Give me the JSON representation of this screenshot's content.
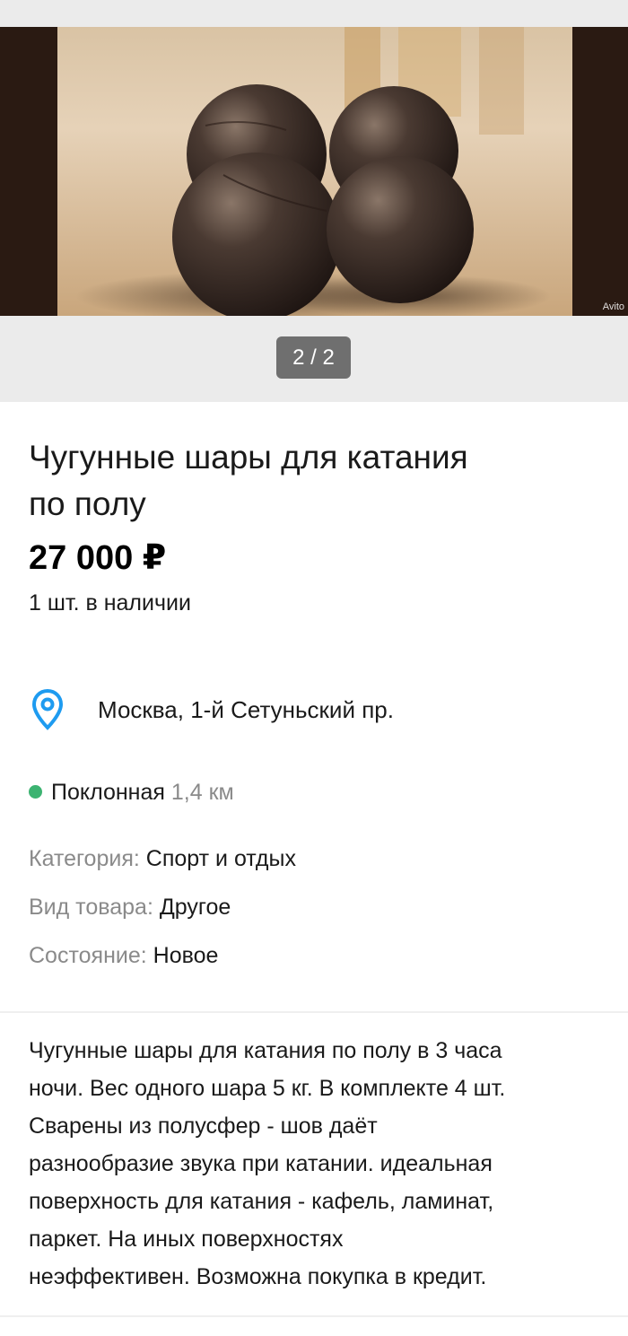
{
  "gallery": {
    "photo_description": "four cast-iron balls on a wooden floor",
    "watermark": "Avito",
    "counter": "2 / 2"
  },
  "listing": {
    "title_line1": "Чугунные шары для катания",
    "title_line2": "по полу",
    "price": "27 000 ₽",
    "stock": "1 шт. в наличии"
  },
  "location": {
    "icon": "location-pin-icon",
    "address": "Москва, 1-й Сетуньский пр."
  },
  "metro": {
    "station": "Поклонная",
    "distance": "1,4 км",
    "line_color": "#3cb371"
  },
  "params": [
    {
      "label": "Категория:",
      "value": "Спорт и отдых"
    },
    {
      "label": "Вид товара:",
      "value": "Другое"
    },
    {
      "label": "Состояние:",
      "value": "Новое"
    }
  ],
  "description": {
    "lines": [
      "Чугунные шары для катания по полу в 3 часа",
      "ночи. Вес одного шара 5 кг. В комплекте 4 шт.",
      "Сварены из полусфер - шов даёт",
      "разнообразие звука при катании. идеальная",
      "поверхность для катания - кафель, ламинат,",
      "паркет. На иных поверхностях",
      "неэффективен. Возможна покупка в кредит."
    ]
  },
  "colors": {
    "accent_pin": "#1e9bf0",
    "text_primary": "#1a1a1a",
    "text_secondary": "#8a8a8a",
    "gallery_bg": "#ebebeb",
    "counter_bg": "#6f6f6f"
  }
}
